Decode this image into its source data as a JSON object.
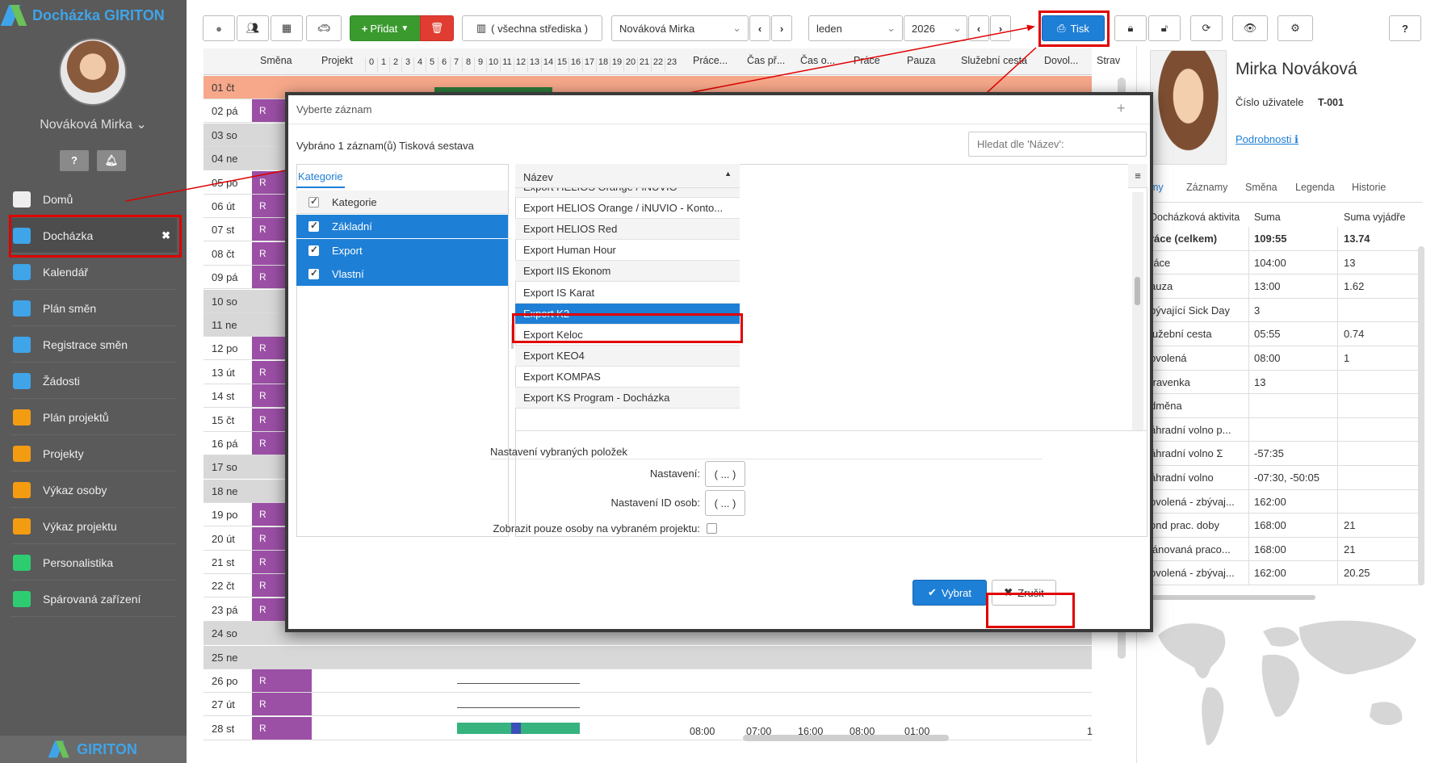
{
  "app": {
    "brand": "Docházka GIRITON",
    "footer_brand": "GIRITON",
    "user_name": "Nováková Mirka"
  },
  "sidebar": {
    "items": [
      {
        "label": "Domů",
        "icon": "home-icon"
      },
      {
        "label": "Docházka",
        "icon": "user-icon",
        "active": true
      },
      {
        "label": "Kalendář",
        "icon": "calendar-icon"
      },
      {
        "label": "Plán směn",
        "icon": "calendar-grid-icon"
      },
      {
        "label": "Registrace směn",
        "icon": "calendar-check-icon"
      },
      {
        "label": "Žádosti",
        "icon": "gavel-icon"
      },
      {
        "label": "Plán projektů",
        "icon": "calendar-orange-icon"
      },
      {
        "label": "Projekty",
        "icon": "folder-calendar-icon"
      },
      {
        "label": "Výkaz osoby",
        "icon": "person-orange-icon"
      },
      {
        "label": "Výkaz projektu",
        "icon": "people-orange-icon"
      },
      {
        "label": "Personalistika",
        "icon": "person-green-icon"
      },
      {
        "label": "Spárovaná zařízení",
        "icon": "phone-icon"
      }
    ]
  },
  "toolbar": {
    "add_label": "Přidat",
    "center_label": "( všechna střediska )",
    "person_select": "Nováková Mirka",
    "month_select": "leden",
    "year_select": "2026",
    "print_label": "Tisk"
  },
  "grid": {
    "columns": {
      "shift": "Směna",
      "project": "Projekt",
      "work": "Práce...",
      "time_from": "Čas př...",
      "time_to": "Čas o...",
      "work2": "Práce",
      "pause": "Pauza",
      "business_trip": "Služební cesta",
      "vacation": "Dovol...",
      "meal": "Strav"
    },
    "hours": [
      "0",
      "1",
      "2",
      "3",
      "4",
      "5",
      "6",
      "7",
      "8",
      "9",
      "10",
      "11",
      "12",
      "13",
      "14",
      "15",
      "16",
      "17",
      "18",
      "19",
      "20",
      "21",
      "22",
      "23"
    ],
    "days": [
      {
        "label": "01 čt",
        "shift": "",
        "type": "holiday"
      },
      {
        "label": "02 pá",
        "shift": "R",
        "type": "work"
      },
      {
        "label": "03 so",
        "shift": "",
        "type": "weekend"
      },
      {
        "label": "04 ne",
        "shift": "",
        "type": "weekend"
      },
      {
        "label": "05 po",
        "shift": "R",
        "type": "work"
      },
      {
        "label": "06 út",
        "shift": "R",
        "type": "work"
      },
      {
        "label": "07 st",
        "shift": "R",
        "type": "work"
      },
      {
        "label": "08 čt",
        "shift": "R",
        "type": "work"
      },
      {
        "label": "09 pá",
        "shift": "R",
        "type": "work"
      },
      {
        "label": "10 so",
        "shift": "",
        "type": "weekend"
      },
      {
        "label": "11 ne",
        "shift": "",
        "type": "weekend"
      },
      {
        "label": "12 po",
        "shift": "R",
        "type": "work"
      },
      {
        "label": "13 út",
        "shift": "R",
        "type": "work"
      },
      {
        "label": "14 st",
        "shift": "R",
        "type": "work"
      },
      {
        "label": "15 čt",
        "shift": "R",
        "type": "work"
      },
      {
        "label": "16 pá",
        "shift": "R",
        "type": "work"
      },
      {
        "label": "17 so",
        "shift": "",
        "type": "weekend"
      },
      {
        "label": "18 ne",
        "shift": "",
        "type": "weekend"
      },
      {
        "label": "19 po",
        "shift": "R",
        "type": "work"
      },
      {
        "label": "20 út",
        "shift": "R",
        "type": "work"
      },
      {
        "label": "21 st",
        "shift": "R",
        "type": "work"
      },
      {
        "label": "22 čt",
        "shift": "R",
        "type": "work"
      },
      {
        "label": "23 pá",
        "shift": "R",
        "type": "work"
      },
      {
        "label": "24 so",
        "shift": "",
        "type": "weekend"
      },
      {
        "label": "25 ne",
        "shift": "",
        "type": "weekend"
      },
      {
        "label": "26 po",
        "shift": "R",
        "type": "work"
      },
      {
        "label": "27 út",
        "shift": "R",
        "type": "work"
      },
      {
        "label": "28 st",
        "shift": "R",
        "type": "work"
      }
    ],
    "last_row_values": [
      "08:00",
      "07:00",
      "16:00",
      "08:00",
      "01:00",
      "1"
    ]
  },
  "profile": {
    "name": "Mirka Nováková",
    "id_label": "Číslo uživatele",
    "id_value": "T-001",
    "details_link": "Podrobnosti"
  },
  "right_tabs": [
    "my",
    "Záznamy",
    "Směna",
    "Legenda",
    "Historie"
  ],
  "summary": {
    "headers": [
      "Docházková aktivita",
      "Suma",
      "Suma vyjádře"
    ],
    "rows": [
      [
        "ráce (celkem)",
        "109:55",
        "13.74"
      ],
      [
        "ráce",
        "104:00",
        "13"
      ],
      [
        "auza",
        "13:00",
        "1.62"
      ],
      [
        "bývající Sick Day",
        "3",
        ""
      ],
      [
        "lužební cesta",
        "05:55",
        "0.74"
      ],
      [
        "ovolená",
        "08:00",
        "1"
      ],
      [
        "travenka",
        "13",
        ""
      ],
      [
        "dměna",
        "",
        ""
      ],
      [
        "áhradní volno p...",
        "",
        ""
      ],
      [
        "áhradní volno Σ",
        "-57:35",
        ""
      ],
      [
        "áhradní volno",
        "-07:30, -50:05",
        ""
      ],
      [
        "ovolená - zbývaj...",
        "162:00",
        ""
      ],
      [
        "ond prac. doby",
        "168:00",
        "21"
      ],
      [
        "lánovaná praco...",
        "168:00",
        "21"
      ],
      [
        "ovolená - zbývaj...",
        "162:00",
        "20.25"
      ]
    ]
  },
  "modal": {
    "title": "Vyberte záznam",
    "selected_text": "Vybráno 1 záznam(ů) Tisková sestava",
    "search_placeholder": "Hledat dle 'Název':",
    "left_tab": "Kategorie",
    "left_header": "Kategorie",
    "categories": [
      "Základní",
      "Export",
      "Vlastní"
    ],
    "list_header": "Název",
    "list_items": [
      "Export HELIOS Orange / iNUVIO",
      "Export HELIOS Orange / iNUVIO - Konto...",
      "Export HELIOS Red",
      "Export Human Hour",
      "Export IIS Ekonom",
      "Export IS Karat",
      "Export K2",
      "Export Keloc",
      "Export KEO4",
      "Export KOMPAS",
      "Export KS Program - Docházka"
    ],
    "selected_item": "Export K2",
    "settings_title": "Nastavení vybraných položek",
    "setting1_label": "Nastavení:",
    "setting2_label": "Nastavení ID osob:",
    "setting3_label": "Zobrazit pouze osoby na vybraném projektu:",
    "ellipsis_btn": "( ... )",
    "select_btn": "Vybrat",
    "cancel_btn": "Zrušit"
  },
  "colors": {
    "accent": "#1e7fd6",
    "shift": "#9b4fa5",
    "highlight": "#e00000",
    "add_btn": "#3a9a2e",
    "delete_btn": "#e03c31"
  }
}
